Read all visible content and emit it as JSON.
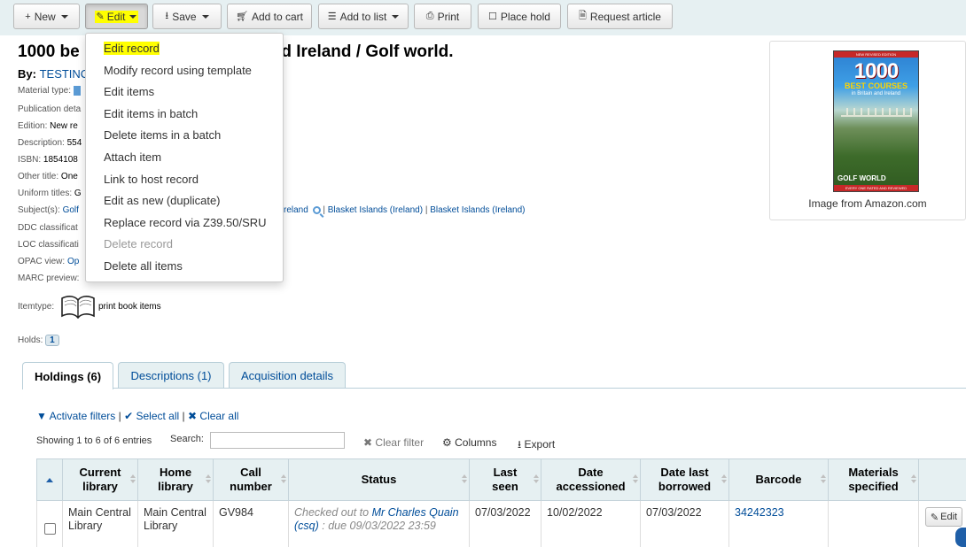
{
  "toolbar": {
    "new_label": "New",
    "edit_label": "Edit",
    "save_label": "Save",
    "add_to_cart_label": "Add to cart",
    "add_to_list_label": "Add to list",
    "print_label": "Print",
    "place_hold_label": "Place hold",
    "request_article_label": "Request article"
  },
  "edit_menu": {
    "items": [
      "Edit record",
      "Modify record using template",
      "Edit items",
      "Edit items in batch",
      "Delete items in a batch",
      "Attach item",
      "Link to host record",
      "Edit as new (duplicate)",
      "Replace record via Z39.50/SRU",
      "Delete record",
      "Delete all items"
    ],
    "disabled_item": "Delete record",
    "highlighted_item": "Edit record"
  },
  "record": {
    "title_left": "1000 be",
    "title_right": "nd Ireland / Golf world.",
    "by_label": "By:",
    "by_value": "TESTINC",
    "material_type_label": "Material type:",
    "publication_label": "Publication deta",
    "edition_label": "Edition:",
    "edition_value": "New re",
    "description_label": "Description:",
    "description_value": "554",
    "isbn_label": "ISBN:",
    "isbn_value": "1854108",
    "other_title_label": "Other title:",
    "other_title_value": "One",
    "uniform_titles_label": "Uniform titles:",
    "uniform_titles_value": "G",
    "subjects_label": "Subject(s):",
    "subject_1": "Golf",
    "subject_2_fragment": "reland",
    "subject_3": "Blasket Islands (Ireland)",
    "subject_4": "Blasket Islands (Ireland)",
    "ddc_label": "DDC classificat",
    "loc_label": "LOC classificati",
    "opac_label": "OPAC view:",
    "opac_value": "Op",
    "marc_label": "MARC preview:",
    "itemtype_label": "Itemtype:",
    "itemtype_value": "print book items",
    "holds_label": "Holds:",
    "holds_count": "1"
  },
  "cover": {
    "caption": "Image from Amazon.com",
    "top_banner": "NEW REVISED EDITION",
    "number": "1000",
    "headline": "BEST COURSES",
    "subline": "in Britain and Ireland",
    "brand": "GOLF WORLD",
    "bottom_banner": "EVERY ONE RATED AND REVIEWED"
  },
  "tabs": [
    {
      "label": "Holdings (6)"
    },
    {
      "label": "Descriptions (1)"
    },
    {
      "label": "Acquisition details"
    }
  ],
  "holdings": {
    "activate_filters": "Activate filters",
    "select_all": "Select all",
    "clear_all": "Clear all",
    "showing": "Showing 1 to 6 of 6 entries",
    "search_label": "Search:",
    "search_value": "",
    "clear_filter": "Clear filter",
    "columns": "Columns",
    "export": "Export",
    "headers": [
      "Current library",
      "Home library",
      "Call number",
      "Status",
      "Last seen",
      "Date accessioned",
      "Date last borrowed",
      "Barcode",
      "Materials specified"
    ],
    "row": {
      "current_library": "Main Central Library",
      "home_library": "Main Central Library",
      "call_number": "GV984",
      "status_prefix": "Checked out to",
      "status_patron": "Mr Charles Quain (csq)",
      "status_due": ": due 09/03/2022 23:59",
      "last_seen": "07/03/2022",
      "date_accessioned": "10/02/2022",
      "date_last_borrowed": "07/03/2022",
      "barcode": "34242323",
      "materials_specified": "",
      "edit_label": "Edit"
    }
  }
}
